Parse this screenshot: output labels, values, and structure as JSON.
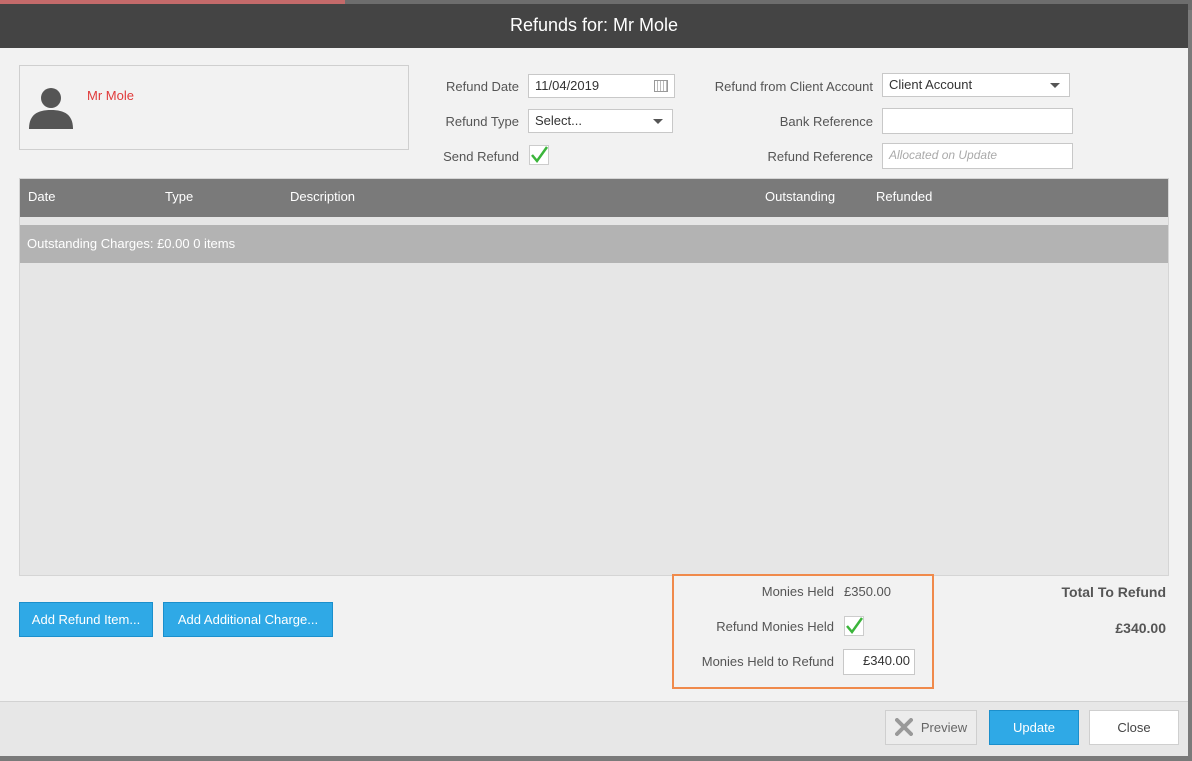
{
  "dialog": {
    "title": "Refunds for: Mr Mole"
  },
  "client": {
    "name": "Mr Mole"
  },
  "form": {
    "refund_date_label": "Refund Date",
    "refund_date_value": "11/04/2019",
    "refund_type_label": "Refund Type",
    "refund_type_value": "Select...",
    "send_refund_label": "Send Refund",
    "send_refund_checked": true,
    "from_client_account_label": "Refund from Client Account",
    "from_client_account_value": "Client Account",
    "bank_reference_label": "Bank Reference",
    "bank_reference_value": "",
    "refund_reference_label": "Refund Reference",
    "refund_reference_placeholder": "Allocated on Update"
  },
  "grid": {
    "columns": [
      "Date",
      "Type",
      "Description",
      "Outstanding",
      "Refunded"
    ],
    "group_label": "Outstanding Charges: £0.00 0 items",
    "rows": []
  },
  "actions": {
    "add_refund_item": "Add Refund Item...",
    "add_additional_charge": "Add Additional Charge..."
  },
  "monies": {
    "held_label": "Monies Held",
    "held_value": "£350.00",
    "refund_held_label": "Refund Monies Held",
    "refund_held_checked": true,
    "held_to_refund_label": "Monies Held to Refund",
    "held_to_refund_value": "£340.00"
  },
  "totals": {
    "label": "Total To Refund",
    "value": "£340.00"
  },
  "footer": {
    "preview": "Preview",
    "update": "Update",
    "close": "Close"
  },
  "colors": {
    "title_bar": "#444444",
    "accent_blue": "#2fa9e6",
    "client_name": "#e03a3a",
    "highlight": "#f08a4b",
    "check_green": "#3bb53b"
  }
}
